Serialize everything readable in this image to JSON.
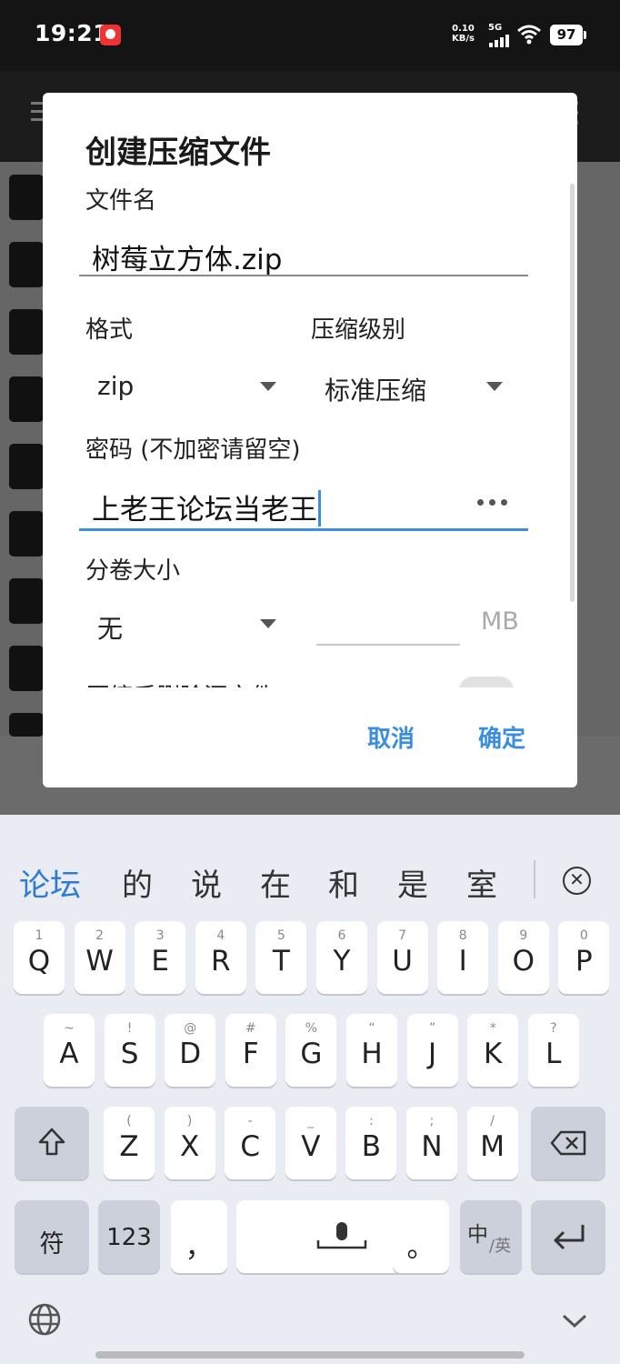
{
  "status_bar": {
    "time": "19:21",
    "net_speed_value": "0.10",
    "net_speed_unit": "KB/s",
    "network": "5G",
    "battery": "97"
  },
  "dialog": {
    "title": "创建压缩文件",
    "filename_label": "文件名",
    "filename_value": "树莓立方体.zip",
    "format_label": "格式",
    "format_value": "zip",
    "level_label": "压缩级别",
    "level_value": "标准压缩",
    "password_label": "密码 (不加密请留空)",
    "password_value": "上老王论坛当老王",
    "volume_label": "分卷大小",
    "volume_value": "无",
    "volume_unit": "MB",
    "cut_option": "压缩后删除源文件",
    "cancel": "取消",
    "ok": "确定"
  },
  "keyboard": {
    "candidates": [
      "论坛",
      "的",
      "说",
      "在",
      "和",
      "是",
      "室"
    ],
    "row1": [
      {
        "k": "Q",
        "s": "1"
      },
      {
        "k": "W",
        "s": "2"
      },
      {
        "k": "E",
        "s": "3"
      },
      {
        "k": "R",
        "s": "4"
      },
      {
        "k": "T",
        "s": "5"
      },
      {
        "k": "Y",
        "s": "6"
      },
      {
        "k": "U",
        "s": "7"
      },
      {
        "k": "I",
        "s": "8"
      },
      {
        "k": "O",
        "s": "9"
      },
      {
        "k": "P",
        "s": "0"
      }
    ],
    "row2": [
      {
        "k": "A",
        "s": "~"
      },
      {
        "k": "S",
        "s": "!"
      },
      {
        "k": "D",
        "s": "@"
      },
      {
        "k": "F",
        "s": "#"
      },
      {
        "k": "G",
        "s": "%"
      },
      {
        "k": "H",
        "s": "“"
      },
      {
        "k": "J",
        "s": "”"
      },
      {
        "k": "K",
        "s": "*"
      },
      {
        "k": "L",
        "s": "?"
      }
    ],
    "row3": [
      {
        "k": "Z",
        "s": "("
      },
      {
        "k": "X",
        "s": ")"
      },
      {
        "k": "C",
        "s": "-"
      },
      {
        "k": "V",
        "s": "_"
      },
      {
        "k": "B",
        "s": ":"
      },
      {
        "k": "N",
        "s": ";"
      },
      {
        "k": "M",
        "s": "/"
      }
    ],
    "symbols_key": "符",
    "numbers_key": "123",
    "comma_key": "，",
    "period_key": "。",
    "lang_key_main": "中",
    "lang_key_sub": "/英"
  }
}
